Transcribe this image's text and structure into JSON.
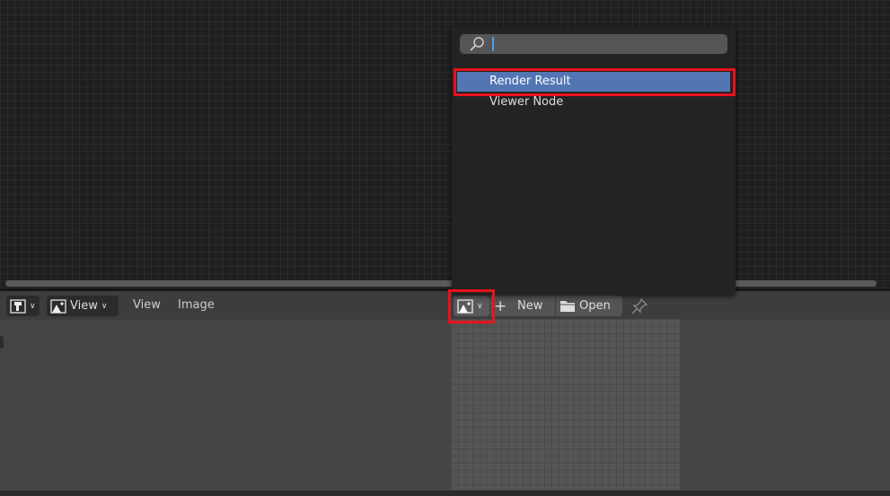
{
  "header": {
    "view_dropdown": "View",
    "menu_view": "View",
    "menu_image": "Image",
    "new_label": "New",
    "open_label": "Open"
  },
  "popup": {
    "search_value": "",
    "items": [
      {
        "label": "Render Result",
        "selected": true
      },
      {
        "label": "Viewer Node",
        "selected": false
      }
    ]
  },
  "colors": {
    "highlight": "#e8121c",
    "selection": "#5276b4"
  }
}
